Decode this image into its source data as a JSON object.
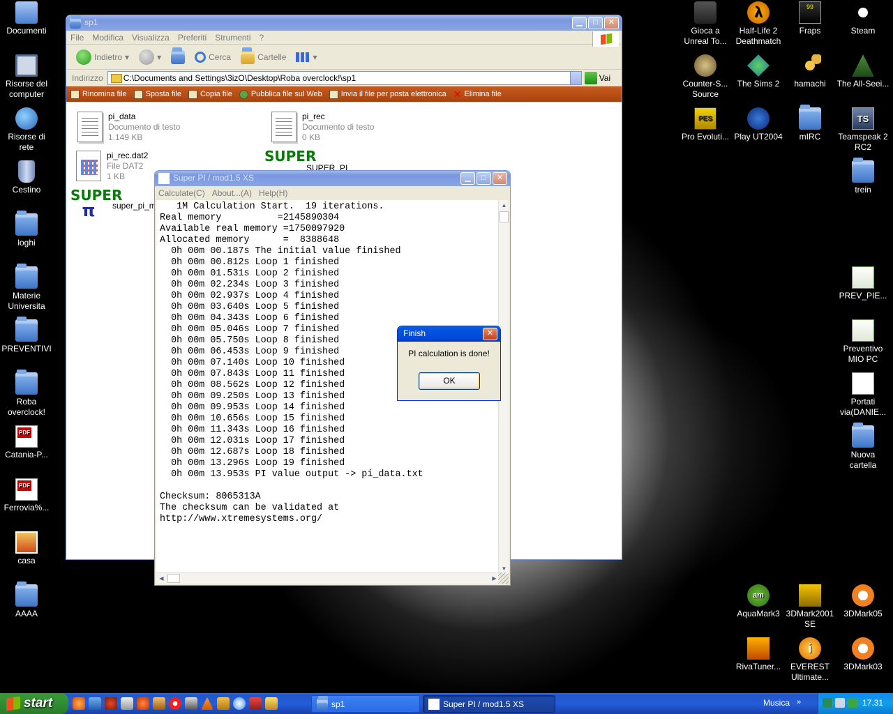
{
  "desktop_left": [
    {
      "label": "Documenti",
      "icon": "my-documents-icon"
    },
    {
      "label": "Risorse del computer",
      "icon": "my-computer-icon"
    },
    {
      "label": "Risorse di rete",
      "icon": "network-icon"
    },
    {
      "label": "Cestino",
      "icon": "recycle-bin-icon"
    },
    {
      "label": "loghi",
      "icon": "folder-icon"
    },
    {
      "label": "Materie Universita",
      "icon": "folder-icon"
    },
    {
      "label": "PREVENTIVI",
      "icon": "folder-icon"
    },
    {
      "label": "Roba overclock!",
      "icon": "folder-icon"
    },
    {
      "label": "Catania-P...",
      "icon": "pdf-icon"
    },
    {
      "label": "Ferrovia%...",
      "icon": "pdf-icon"
    },
    {
      "label": "casa",
      "icon": "image-icon"
    },
    {
      "label": "AAAA",
      "icon": "folder-icon"
    }
  ],
  "desktop_right": {
    "gioca": "Gioca a Unreal To...",
    "halflife": "Half-Life 2 Deathmatch",
    "fraps": "Fraps",
    "fraps_badge": "99",
    "steam": "Steam",
    "counter": "Counter-S... Source",
    "sims": "The Sims 2",
    "hamachi": "hamachi",
    "allseeing": "The All-Seei...",
    "pro": "Pro Evoluti...",
    "pes_badge": "PES",
    "playut": "Play UT2004",
    "mirc": "mIRC",
    "teamspeak": "Teamspeak 2 RC2",
    "ts_badge": "TS",
    "trein": "trein",
    "prev_pie": "PREV_PIE...",
    "preventivo": "Preventivo MIO PC",
    "portati": "Portati via(DANIE...",
    "nuova": "Nuova cartella",
    "aquamark": "AquaMark3",
    "aquamark_badge": "am",
    "mark2001": "3DMark2001 SE",
    "mark05": "3DMark05",
    "riva": "RivaTuner...",
    "everest": "EVEREST Ultimate...",
    "everest_badge": "i",
    "mark03": "3DMark03"
  },
  "explorer": {
    "title": "sp1",
    "menu": [
      "File",
      "Modifica",
      "Visualizza",
      "Preferiti",
      "Strumenti",
      "?"
    ],
    "toolbar": {
      "back": "Indietro",
      "search": "Cerca",
      "folders": "Cartelle"
    },
    "address_label": "Indirizzo",
    "address": "C:\\Documents and Settings\\3izO\\Desktop\\Roba overclock!\\sp1",
    "go": "Vai",
    "tasks": [
      "Rinomina file",
      "Sposta file",
      "Copia file",
      "Pubblica file sul Web",
      "Invia il file per posta elettronica",
      "Elimina file"
    ],
    "files": [
      {
        "name": "pi_data",
        "type": "Documento di testo",
        "size": "1.149 KB"
      },
      {
        "name": "pi_rec",
        "type": "Documento di testo",
        "size": "0 KB"
      },
      {
        "name": "pi_rec.dat2",
        "type": "File DAT2",
        "size": "1 KB"
      },
      {
        "name": "SUPER_PI",
        "type": "",
        "size": ""
      },
      {
        "name": "super_pi_m",
        "type": "",
        "size": ""
      }
    ],
    "super_logo": "SUPER",
    "super_logo_pi": "π"
  },
  "superpi": {
    "title": "Super PI / mod1.5 XS",
    "menu": [
      "Calculate(C)",
      "About...(A)",
      "Help(H)"
    ],
    "output": [
      "   1M Calculation Start.  19 iterations.",
      "Real memory          =2145890304",
      "Available real memory =1750097920",
      "Allocated memory      =  8388648",
      "  0h 00m 00.187s The initial value finished",
      "  0h 00m 00.812s Loop 1 finished",
      "  0h 00m 01.531s Loop 2 finished",
      "  0h 00m 02.234s Loop 3 finished",
      "  0h 00m 02.937s Loop 4 finished",
      "  0h 00m 03.640s Loop 5 finished",
      "  0h 00m 04.343s Loop 6 finished",
      "  0h 00m 05.046s Loop 7 finished",
      "  0h 00m 05.750s Loop 8 finished",
      "  0h 00m 06.453s Loop 9 finished",
      "  0h 00m 07.140s Loop 10 finished",
      "  0h 00m 07.843s Loop 11 finished",
      "  0h 00m 08.562s Loop 12 finished",
      "  0h 00m 09.250s Loop 13 finished",
      "  0h 00m 09.953s Loop 14 finished",
      "  0h 00m 10.656s Loop 15 finished",
      "  0h 00m 11.343s Loop 16 finished",
      "  0h 00m 12.031s Loop 17 finished",
      "  0h 00m 12.687s Loop 18 finished",
      "  0h 00m 13.296s Loop 19 finished",
      "  0h 00m 13.953s PI value output -> pi_data.txt",
      "",
      "Checksum: 8065313A",
      "The checksum can be validated at",
      "http://www.xtremesystems.org/"
    ]
  },
  "finish": {
    "title": "Finish",
    "message": "PI calculation is done!",
    "ok": "OK"
  },
  "taskbar": {
    "start": "start",
    "tasks": [
      "sp1",
      "Super PI / mod1.5 XS"
    ],
    "toolbar_label": "Musica",
    "toolbar_chevron": "»",
    "clock": "17.31"
  },
  "glyphs": {
    "minimize": "▁",
    "maximize": "□",
    "close": "✕",
    "dropdown": "▾",
    "arrow_up": "▲",
    "arrow_down": "▼",
    "arrow_left": "◀",
    "arrow_right": "▶"
  },
  "colors": {
    "titlebar_active": "#0554e3",
    "titlebar_inactive": "#7a96df",
    "window_face": "#ece9d8",
    "tasks_bar": "#b9501a",
    "taskbar": "#245ddb",
    "start_green": "#379737"
  }
}
